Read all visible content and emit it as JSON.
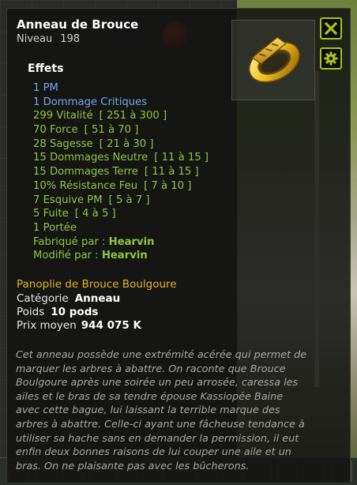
{
  "item": {
    "name": "Anneau de Brouce",
    "level_label": "Niveau",
    "level": "198"
  },
  "effects_heading": "Effets",
  "effects": [
    {
      "text": "1 PM",
      "range": "",
      "color": "blue"
    },
    {
      "text": "1 Dommage Critiques",
      "range": "",
      "color": "blue"
    },
    {
      "text": "299 Vitalité",
      "range": "[ 251 à 300 ]",
      "color": "green"
    },
    {
      "text": "70 Force",
      "range": "[ 51 à 70 ]",
      "color": "green"
    },
    {
      "text": "28 Sagesse",
      "range": "[ 21 à 30 ]",
      "color": "green"
    },
    {
      "text": "15 Dommages Neutre",
      "range": "[ 11 à 15 ]",
      "color": "green"
    },
    {
      "text": "15 Dommages Terre",
      "range": "[ 11 à 15 ]",
      "color": "green"
    },
    {
      "text": "10% Résistance Feu",
      "range": "[ 7 à 10 ]",
      "color": "green"
    },
    {
      "text": "7 Esquive PM",
      "range": "[ 5 à 7 ]",
      "color": "green"
    },
    {
      "text": "5 Fuite",
      "range": "[ 4 à 5 ]",
      "color": "green"
    },
    {
      "text": "1 Portée",
      "range": "",
      "color": "green"
    }
  ],
  "crafted_by_label": "Fabriqué par :",
  "crafted_by": "Hearvin",
  "modified_by_label": "Modifié par :",
  "modified_by": "Hearvin",
  "panoply": "Panoplie de Brouce Boulgoure",
  "category_label": "Catégorie",
  "category": "Anneau",
  "pods_label": "Poids",
  "pods": "10 pods",
  "price_label": "Prix moyen",
  "price": "944 075 K",
  "description": "Cet anneau possède une extrémité acérée qui permet de marquer les arbres à abattre. On raconte que Brouce Boulgoure après une soirée un peu arrosée, caressa les ailes et le bras de sa tendre épouse Kassiopée Baine avec cette bague, lui laissant la terrible marque des arbres à abattre. Celle-ci ayant une fâcheuse tendance à utiliser sa hache sans en demander la permission, il eut enfin deux bonnes raisons de lui couper une aile et un bras. On ne plaisante pas avec les bûcherons.",
  "icons": {
    "close": "close-icon",
    "settings": "gear-icon",
    "item": "gold-ring-icon"
  },
  "colors": {
    "accent_button": "#a7c21a",
    "effect_blue": "#6fa7e8",
    "effect_green": "#8ec63f",
    "panoply": "#e8b028"
  }
}
